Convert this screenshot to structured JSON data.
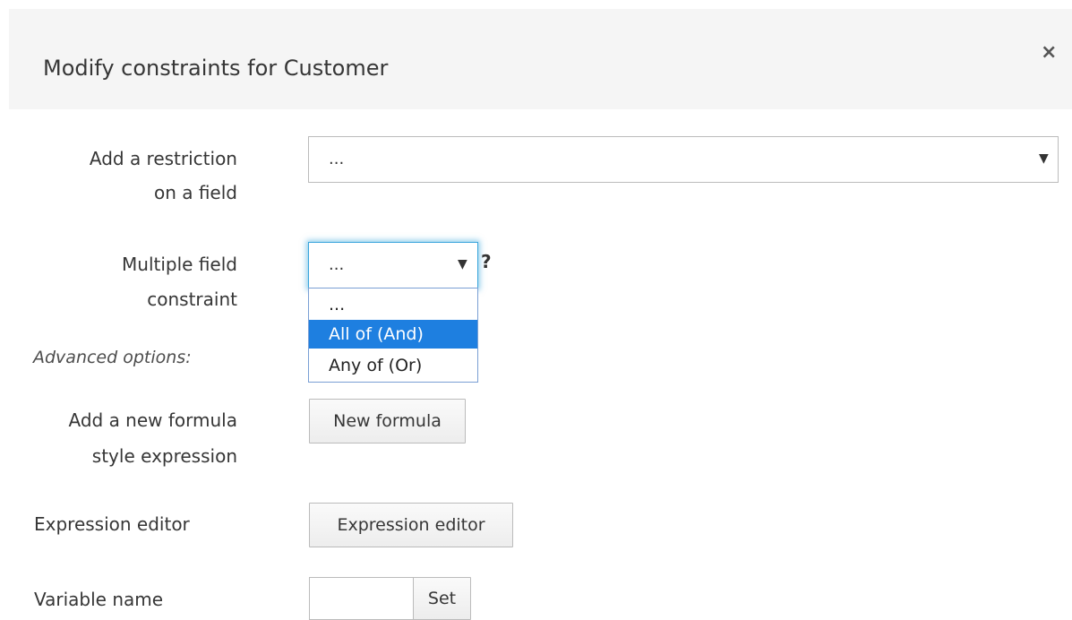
{
  "dialog": {
    "title": "Modify constraints for Customer",
    "close_icon": "close-icon",
    "close_glyph": "×"
  },
  "restriction": {
    "label_line1": "Add a restriction",
    "label_line2": "on a field",
    "selected": "...",
    "arrow": "▼"
  },
  "multiple": {
    "label_line1": "Multiple field",
    "label_line2": "constraint",
    "selected": "...",
    "arrow": "▼",
    "help": "?",
    "options": [
      "...",
      "All of (And)",
      "Any of (Or)"
    ],
    "highlighted_option": "All of (And)"
  },
  "advanced": {
    "label": "Advanced options:"
  },
  "formula": {
    "label_line1": "Add a new formula",
    "label_line2": "style expression",
    "button": "New formula"
  },
  "expression": {
    "label": "Expression editor",
    "button": "Expression editor"
  },
  "variable": {
    "label": "Variable name",
    "value": "",
    "button": "Set"
  },
  "colors": {
    "header_bg": "#f5f5f5",
    "focus_ring": "#39a5dc",
    "option_highlight": "#1e7fe0"
  }
}
